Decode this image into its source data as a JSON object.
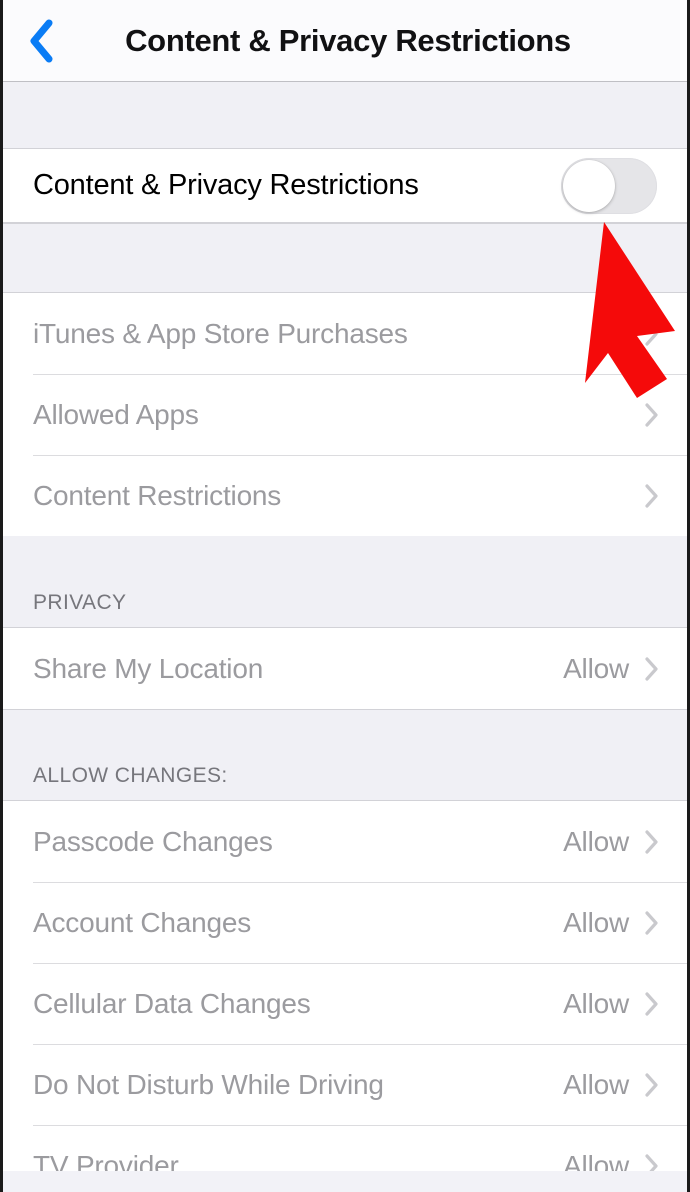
{
  "navbar": {
    "back_icon": "chevron-left-icon",
    "back_label": "",
    "title": "Content & Privacy Restrictions",
    "accent_color": "#0a7cf5"
  },
  "toggle_row": {
    "label": "Content & Privacy Restrictions",
    "toggle_state": "off",
    "toggle_track_color": "#e5e5e8",
    "toggle_knob_color": "#ffffff"
  },
  "restrictions_group": {
    "rows": [
      {
        "label": "iTunes & App Store Purchases",
        "value": "",
        "disabled": true
      },
      {
        "label": "Allowed Apps",
        "value": "",
        "disabled": true
      },
      {
        "label": "Content Restrictions",
        "value": "",
        "disabled": true
      }
    ]
  },
  "privacy_section": {
    "header": "PRIVACY",
    "rows": [
      {
        "label": "Share My Location",
        "value": "Allow",
        "disabled": true
      }
    ]
  },
  "allow_changes_section": {
    "header": "ALLOW CHANGES:",
    "rows": [
      {
        "label": "Passcode Changes",
        "value": "Allow",
        "disabled": true
      },
      {
        "label": "Account Changes",
        "value": "Allow",
        "disabled": true
      },
      {
        "label": "Cellular Data Changes",
        "value": "Allow",
        "disabled": true
      },
      {
        "label": "Do Not Disturb While Driving",
        "value": "Allow",
        "disabled": true
      },
      {
        "label": "TV Provider",
        "value": "Allow",
        "disabled": true
      }
    ]
  },
  "annotation": {
    "type": "arrow",
    "color": "#f50a0a",
    "points_to": "content-privacy-restrictions-toggle"
  }
}
